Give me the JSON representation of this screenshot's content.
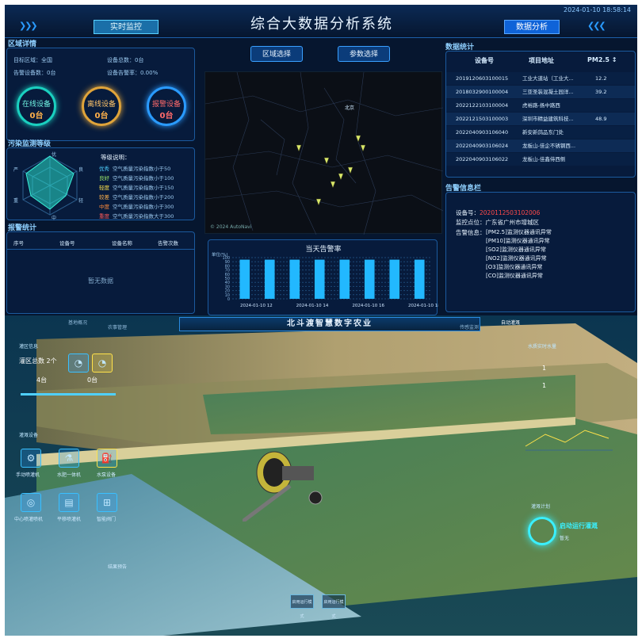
{
  "header": {
    "title": "综合大数据分析系统",
    "datetime": "2024-01-10 18:58:14",
    "tab_left": "实时监控",
    "tab_right": "数据分析"
  },
  "region": {
    "title": "区域详情",
    "target_label": "目标区域：全国",
    "device_total": "设备总数：0台",
    "alert_devices": "告警设备数：0台",
    "device_alert_rate": "设备告警率：0.00%",
    "online": {
      "label": "在线设备",
      "value": "0台"
    },
    "offline": {
      "label": "离线设备",
      "value": "0台"
    },
    "alarm": {
      "label": "报警设备",
      "value": "0台"
    }
  },
  "pollution": {
    "title": "污染监测等级",
    "radar_labels": [
      "优",
      "良",
      "轻",
      "中",
      "重",
      "严"
    ],
    "legend_title": "等级说明：",
    "levels": [
      {
        "name": "优秀",
        "desc": "空气质量污染指数小于50",
        "color": "#4fd0ff"
      },
      {
        "name": "良好",
        "desc": "空气质量污染指数小于100",
        "color": "#9be86a"
      },
      {
        "name": "轻度",
        "desc": "空气质量污染指数小于150",
        "color": "#ffe24a"
      },
      {
        "name": "较差",
        "desc": "空气质量污染指数小于200",
        "color": "#ffb14a"
      },
      {
        "name": "中度",
        "desc": "空气质量污染指数小于300",
        "color": "#ff8a3a"
      },
      {
        "name": "重度",
        "desc": "空气质量污染指数大于300",
        "color": "#ff5a5a"
      }
    ]
  },
  "alarm_stats": {
    "title": "报警统计",
    "columns": [
      "序号",
      "设备号",
      "设备名称",
      "告警次数"
    ],
    "empty": "暂无数据"
  },
  "map": {
    "btn_region": "区域选择",
    "btn_params": "参数选择",
    "attribution": "© 2024 AutoNavi",
    "place": "北京"
  },
  "alarm_rate": {
    "title": "当天告警率",
    "unit": "单位(%)",
    "yticks": [
      "100",
      "90",
      "80",
      "70",
      "60",
      "50",
      "40",
      "30",
      "20",
      "10",
      "0"
    ],
    "xticks": [
      "2024-01-10 12",
      "2024-01-10 14",
      "2024-01-10 16",
      "2024-01-10 18"
    ]
  },
  "chart_data": {
    "type": "bar",
    "title": "当天告警率",
    "ylabel": "单位(%)",
    "ylim": [
      0,
      100
    ],
    "values": [
      95,
      95,
      95,
      95,
      95,
      95,
      95,
      95
    ]
  },
  "stats": {
    "title": "数据统计",
    "columns": [
      "设备号",
      "项目地址",
      "PM2.5 ↕"
    ],
    "rows": [
      [
        "2019120603100015",
        "工业大道站（工业大...",
        "12.2"
      ],
      [
        "2018032900100004",
        "三亚圣装混凝土园洋...",
        "39.2"
      ],
      [
        "2022122103100004",
        "虎裕路-扬中路西",
        ""
      ],
      [
        "2022121503100003",
        "深圳市精益建筑科技...",
        "48.9"
      ],
      [
        "2022040903106040",
        "新安新鸽品东门处",
        ""
      ],
      [
        "2022040903106024",
        "龙板山-佳企不锈钢西...",
        ""
      ],
      [
        "2022040903106022",
        "龙板山-佳鑫侍西侧",
        ""
      ]
    ]
  },
  "alarm_info": {
    "title": "告警信息栏",
    "device_label": "设备号：",
    "device_no": "2020112503102006",
    "point": "监控点位：广东省广州市增城区",
    "info_label": "告警信息：",
    "messages": [
      "[PM2.5]监测仪器通讯异常",
      "[PM10]监测仪器通讯异常",
      "[SO2]监测仪器通讯异常",
      "[NO2]监测仪器通讯异常",
      "[O3]监测仪器通讯异常",
      "[CO]监测仪器通讯异常"
    ]
  },
  "farm": {
    "title": "北斗渡智慧数字农业",
    "nav": [
      "基地概况",
      "农事管理",
      "传感监测",
      "自动灌溉"
    ],
    "area_title": "灌区信息",
    "area_total": "灌区总数 2个",
    "stat1": "4台",
    "stat2": "0台",
    "equip_title": "灌溉设备",
    "equip": [
      "手动喷灌机",
      "水肥一体机",
      "水泵设备",
      "中心喷灌喷机",
      "平移喷灌机",
      "智能阀门"
    ],
    "right_title": "水质实时水量",
    "right_vals": [
      "1",
      "1"
    ],
    "plan_title": "灌溉计划",
    "plan_btn": "启动运行灌溉",
    "plan_sub": "暂无",
    "bottom_btn1": "启用运行模式",
    "bottom_btn2": "启用运行模式",
    "note": "结果预告"
  }
}
